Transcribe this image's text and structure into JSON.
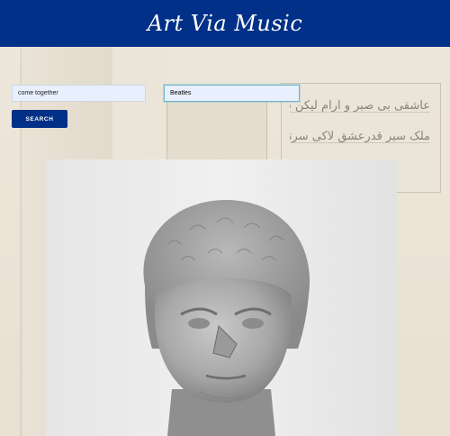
{
  "header": {
    "title": "Art Via Music"
  },
  "search": {
    "song_value": "come together",
    "artist_value": "Beatles",
    "button_label": "SEARCH"
  },
  "artwork": {
    "subject": "marble portrait head sculpture (black and white photograph)"
  },
  "background": {
    "script_lines": [
      "عاشقی بی صبر و آرام لیکن سیلیج مینه",
      "ملک سیر قدرعشق لاکی سرنیز"
    ]
  },
  "colors": {
    "header_bg": "#003087",
    "button_bg": "#003087",
    "input_bg": "#e8f0fe",
    "active_input_border": "#6fb7c9"
  }
}
